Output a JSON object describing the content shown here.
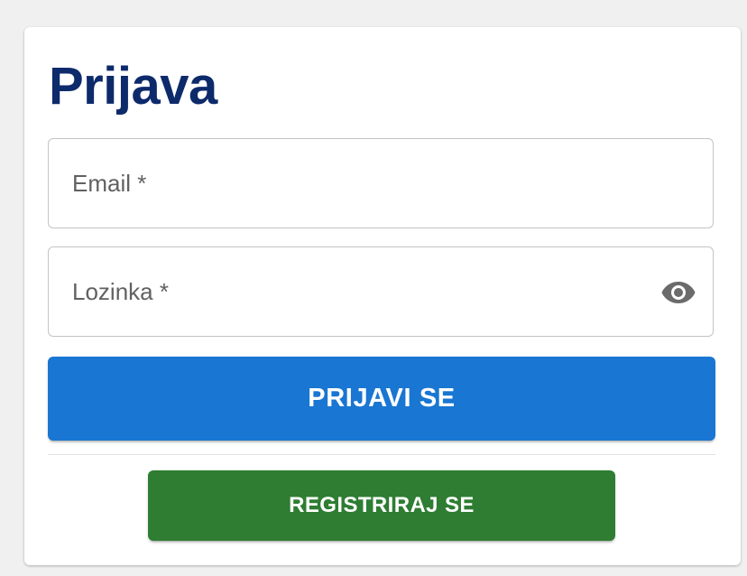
{
  "login": {
    "title": "Prijava",
    "email_label": "Email *",
    "email_value": "",
    "password_label": "Lozinka *",
    "password_value": "",
    "password_toggle_icon": "eye-icon",
    "submit_label": "PRIJAVI SE",
    "register_label": "REGISTRIRAJ SE"
  },
  "colors": {
    "title": "#0d2a6b",
    "primary_button": "#1976d2",
    "register_button": "#2e7d32",
    "field_border": "#c4c4c4",
    "label_text": "#616161",
    "icon": "#6b6b6b"
  }
}
